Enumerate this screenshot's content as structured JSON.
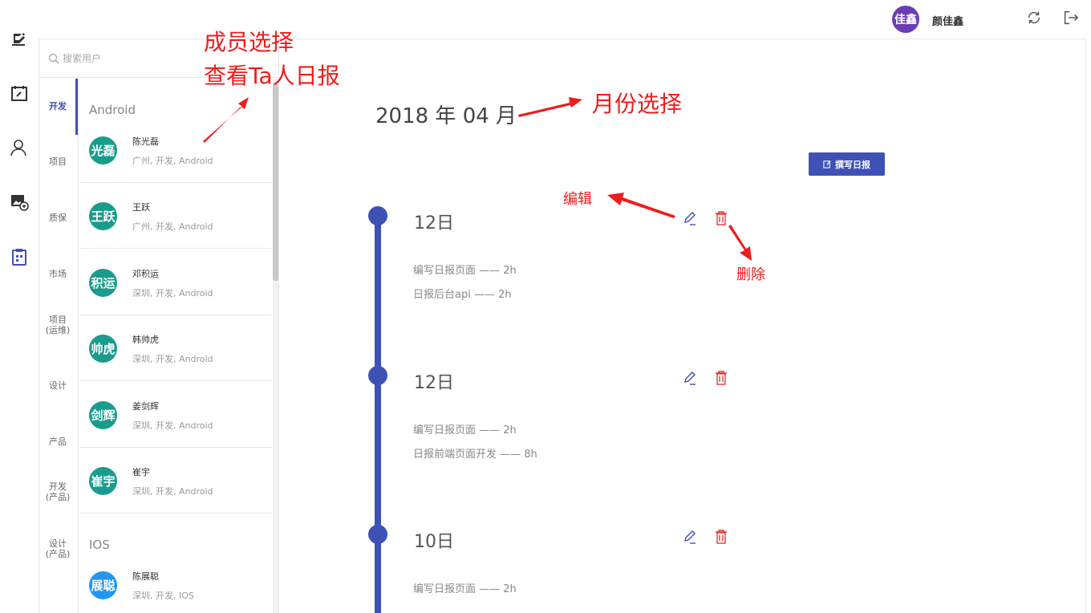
{
  "topbar": {
    "avatar_text": "佳鑫",
    "username": "颜佳鑫",
    "refresh_icon": "refresh-icon",
    "logout_icon": "logout-icon"
  },
  "rail": {
    "icons": [
      "notes-icon",
      "calendar-edit-icon",
      "user-icon",
      "image-settings-icon",
      "clipboard-icon"
    ]
  },
  "search": {
    "placeholder": "搜索用户"
  },
  "departments": [
    {
      "label": "开发",
      "active": true
    },
    {
      "label": "项目"
    },
    {
      "label": "质保"
    },
    {
      "label": "市场"
    },
    {
      "label": "项目\n(运维)"
    },
    {
      "label": "设计"
    },
    {
      "label": "产品"
    },
    {
      "label": "开发\n(产品)"
    },
    {
      "label": "设计\n(产品)"
    }
  ],
  "groups": {
    "android": "Android",
    "ios": "IOS"
  },
  "members": [
    {
      "avatar": "光磊",
      "name": "陈光磊",
      "sub": "广州, 开发, Android",
      "color": "#1a9c8c"
    },
    {
      "avatar": "王跃",
      "name": "王跃",
      "sub": "广州, 开发, Android",
      "color": "#1a9c8c"
    },
    {
      "avatar": "积运",
      "name": "邓积运",
      "sub": "深圳, 开发, Android",
      "color": "#1a9c8c"
    },
    {
      "avatar": "帅虎",
      "name": "韩帅虎",
      "sub": "深圳, 开发, Android",
      "color": "#1a9c8c"
    },
    {
      "avatar": "剑辉",
      "name": "姜剑辉",
      "sub": "深圳, 开发, Android",
      "color": "#1a9c8c"
    },
    {
      "avatar": "崔宇",
      "name": "崔宇",
      "sub": "深圳, 开发, Android",
      "color": "#1a9c8c"
    },
    {
      "avatar": "展聪",
      "name": "陈展聪",
      "sub": "深圳, 开发, IOS",
      "color": "#2196f3"
    }
  ],
  "main": {
    "month_title": "2018 年 04 月",
    "write_button": "撰写日报",
    "write_icon": "edit-square-icon",
    "reports": [
      {
        "day": "12日",
        "entries": [
          "编写日报页面 —— 2h",
          "日报后台api —— 2h"
        ]
      },
      {
        "day": "12日",
        "entries": [
          "编写日报页面 —— 2h",
          "日报前端页面开发 —— 8h"
        ]
      },
      {
        "day": "10日",
        "entries": [
          "编写日报页面 —— 2h"
        ]
      }
    ]
  },
  "annotations": {
    "member_select_line1": "成员选择",
    "member_select_line2": "查看Ta人日报",
    "month_select": "月份选择",
    "edit": "编辑",
    "delete": "删除"
  },
  "colors": {
    "primary": "#3f51b5",
    "annotation": "#ee1c1c",
    "delete": "#e53935",
    "avatar_top": "#6a3db5"
  }
}
